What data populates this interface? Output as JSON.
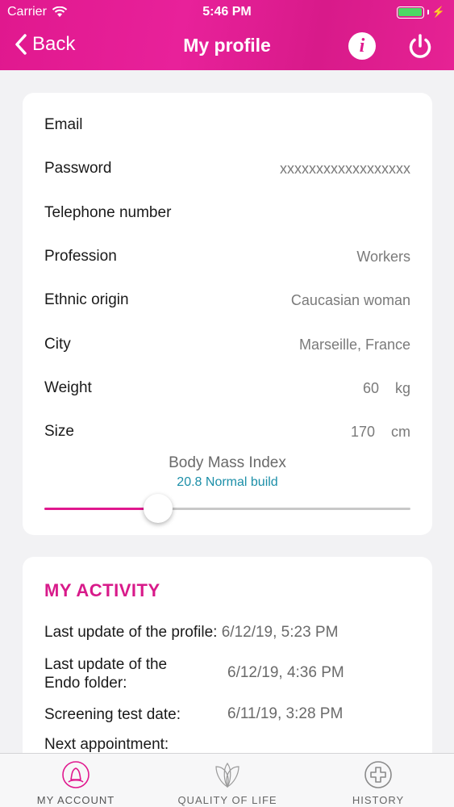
{
  "status_bar": {
    "carrier": "Carrier",
    "time": "5:46 PM"
  },
  "nav": {
    "back_label": "Back",
    "title": "My profile",
    "info_label": "i"
  },
  "profile": {
    "rows": [
      {
        "label": "Email",
        "value": ""
      },
      {
        "label": "Password",
        "value": "xxxxxxxxxxxxxxxxxx"
      },
      {
        "label": "Telephone number",
        "value": ""
      },
      {
        "label": "Profession",
        "value": "Workers"
      },
      {
        "label": "Ethnic origin",
        "value": "Caucasian woman"
      },
      {
        "label": "City",
        "value": "Marseille, France"
      }
    ],
    "weight": {
      "label": "Weight",
      "value": "60",
      "unit": "kg"
    },
    "size": {
      "label": "Size",
      "value": "170",
      "unit": "cm"
    },
    "bmi": {
      "title": "Body Mass Index",
      "value_text": "20.8 Normal build",
      "slider_fraction": 0.31
    }
  },
  "activity": {
    "title": "MY ACTIVITY",
    "profile_update": {
      "label": "Last update of the profile:",
      "value": "6/12/19, 5:23 PM"
    },
    "endo_update": {
      "label_line1": "Last update of the",
      "label_line2": "Endo folder:",
      "value": "6/12/19, 4:36 PM"
    },
    "screening": {
      "label": "Screening test date:",
      "value": "6/11/19, 3:28 PM"
    },
    "next_appointment": {
      "label": "Next appointment:"
    }
  },
  "tabs": [
    {
      "label": "MY ACCOUNT",
      "icon": "account-icon",
      "active": true
    },
    {
      "label": "QUALITY OF LIFE",
      "icon": "quality-of-life-icon",
      "active": false
    },
    {
      "label": "HISTORY",
      "icon": "history-icon",
      "active": false
    }
  ],
  "colors": {
    "brand": "#e0188e",
    "bmi_text": "#1c8fa8",
    "battery": "#4cd964"
  }
}
